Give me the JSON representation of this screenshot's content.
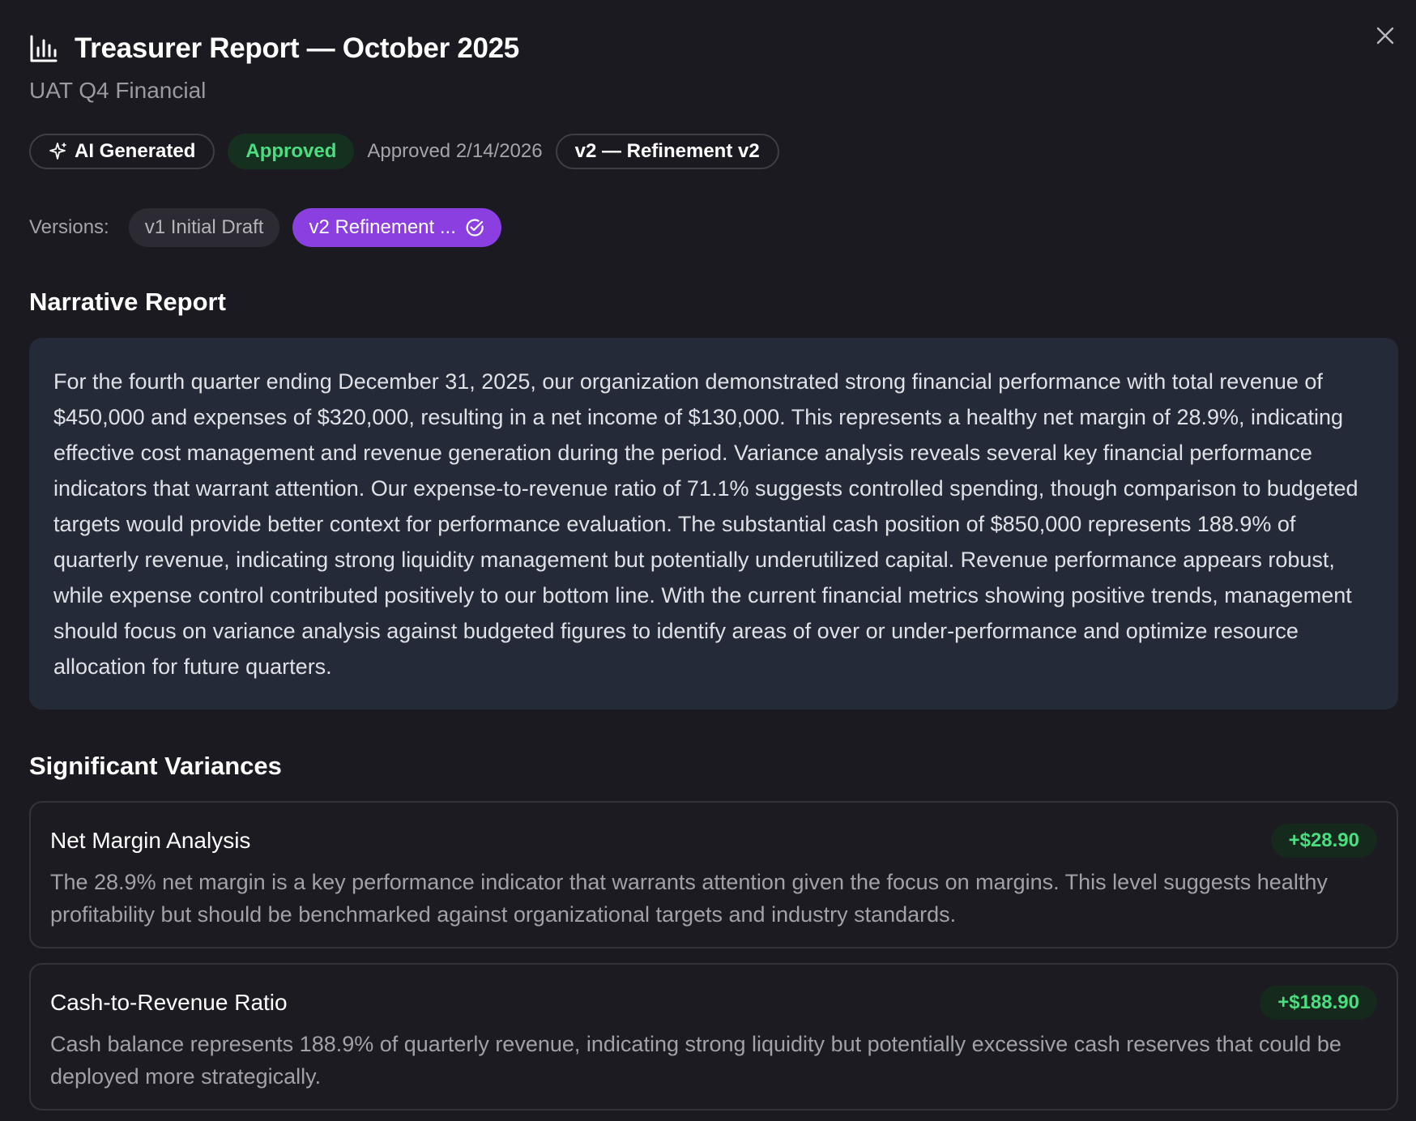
{
  "header": {
    "title": "Treasurer Report — October 2025",
    "subtitle": "UAT Q4 Financial",
    "close_icon": "close-icon",
    "title_icon": "bar-chart-icon"
  },
  "badges": {
    "ai_generated": "AI Generated",
    "ai_icon": "sparkle-icon",
    "status": "Approved",
    "approved_date": "Approved 2/14/2026",
    "version": "v2 — Refinement v2"
  },
  "versions": {
    "label": "Versions:",
    "items": [
      {
        "label": "v1 Initial Draft",
        "active": false
      },
      {
        "label": "v2 Refinement ...",
        "active": true,
        "icon": "check-circle-icon"
      }
    ]
  },
  "narrative": {
    "heading": "Narrative Report",
    "text": "For the fourth quarter ending December 31, 2025, our organization demonstrated strong financial performance with total revenue of $450,000 and expenses of $320,000, resulting in a net income of $130,000. This represents a healthy net margin of 28.9%, indicating effective cost management and revenue generation during the period. Variance analysis reveals several key financial performance indicators that warrant attention. Our expense-to-revenue ratio of 71.1% suggests controlled spending, though comparison to budgeted targets would provide better context for performance evaluation. The substantial cash position of $850,000 represents 188.9% of quarterly revenue, indicating strong liquidity management but potentially underutilized capital. Revenue performance appears robust, while expense control contributed positively to our bottom line. With the current financial metrics showing positive trends, management should focus on variance analysis against budgeted figures to identify areas of over or under-performance and optimize resource allocation for future quarters."
  },
  "variances": {
    "heading": "Significant Variances",
    "items": [
      {
        "title": "Net Margin Analysis",
        "amount": "+$28.90",
        "description": "The 28.9% net margin is a key performance indicator that warrants attention given the focus on margins. This level suggests healthy profitability but should be benchmarked against organizational targets and industry standards."
      },
      {
        "title": "Cash-to-Revenue Ratio",
        "amount": "+$188.90",
        "description": "Cash balance represents 188.9% of quarterly revenue, indicating strong liquidity but potentially excessive cash reserves that could be deployed more strategically."
      }
    ]
  },
  "colors": {
    "background": "#1b1a20",
    "accent_purple": "#8b3fe0",
    "success_green": "#4ade80",
    "narrative_bg": "#242a37"
  }
}
